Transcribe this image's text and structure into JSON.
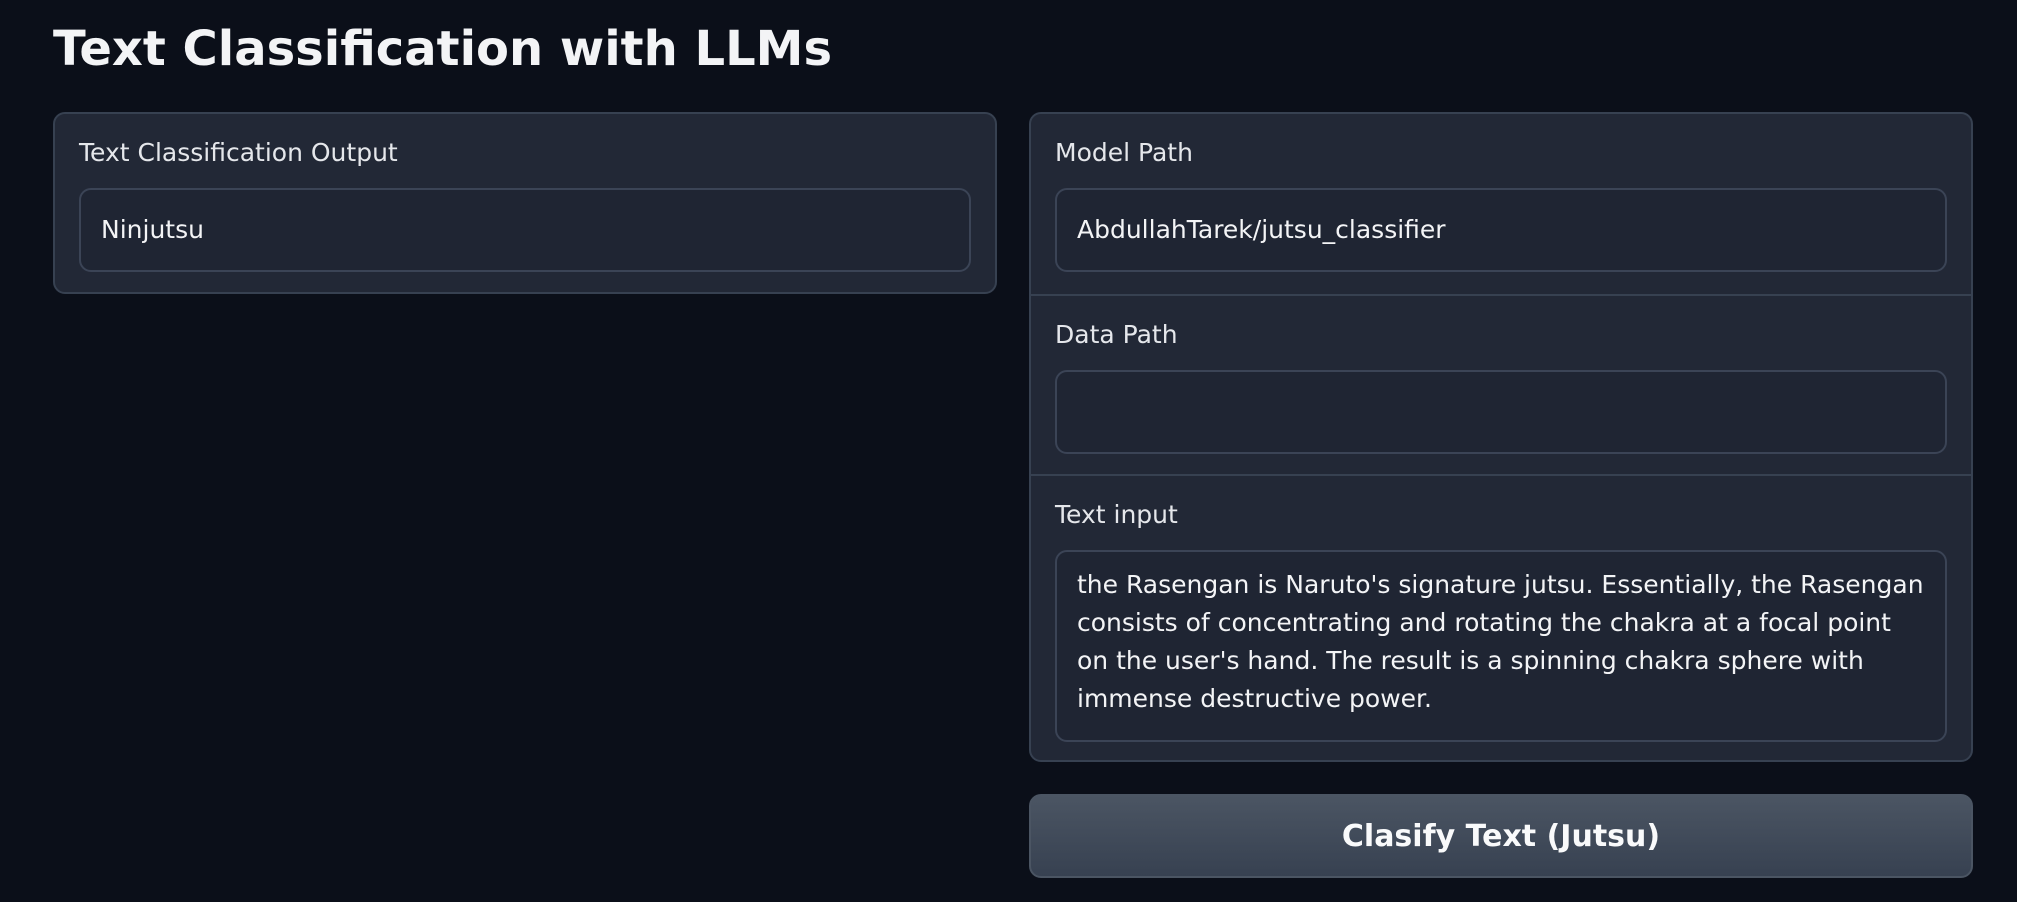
{
  "page": {
    "title": "Text Classification with LLMs"
  },
  "output_panel": {
    "label": "Text Classification Output",
    "value": "Ninjutsu"
  },
  "inputs_panel": {
    "model_path": {
      "label": "Model Path",
      "value": "AbdullahTarek/jutsu_classifier"
    },
    "data_path": {
      "label": "Data Path",
      "value": ""
    },
    "text_input": {
      "label": "Text input",
      "value": "the Rasengan is Naruto's signature jutsu. Essentially, the Rasengan consists of concentrating and rotating the chakra at a focal point on the user's hand. The result is a spinning chakra sphere with immense destructive power."
    }
  },
  "actions": {
    "classify_label": "Clasify Text (Jutsu)"
  },
  "colors": {
    "background": "#0b0f19",
    "panel": "#222836",
    "field": "#1f2533",
    "border": "#374151",
    "button": "#4b5563",
    "text": "#f3f4f6"
  }
}
